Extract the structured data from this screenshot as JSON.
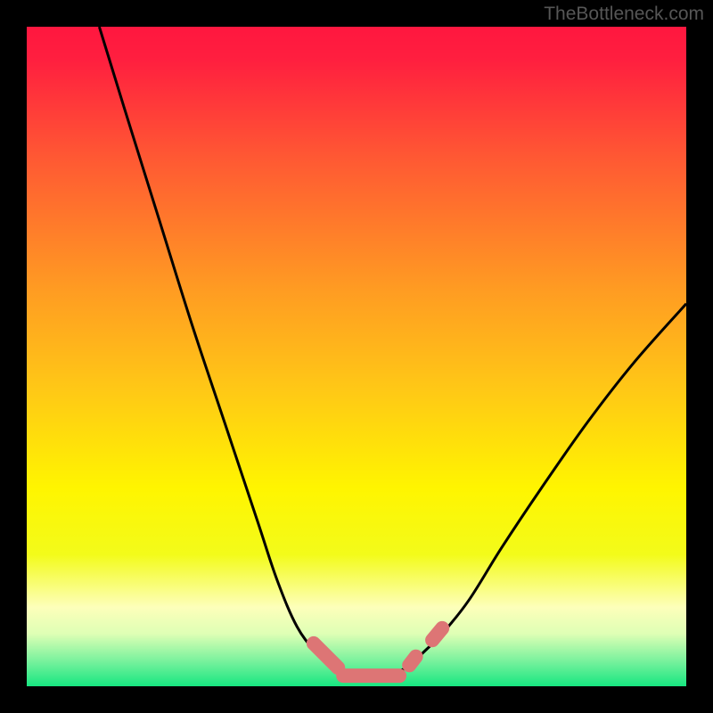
{
  "watermark": "TheBottleneck.com",
  "colors": {
    "frame": "#000000",
    "gradient_stops": [
      {
        "offset": 0.0,
        "color": "#ff173f"
      },
      {
        "offset": 0.05,
        "color": "#ff1f3f"
      },
      {
        "offset": 0.2,
        "color": "#ff5933"
      },
      {
        "offset": 0.4,
        "color": "#ff9c22"
      },
      {
        "offset": 0.55,
        "color": "#ffc816"
      },
      {
        "offset": 0.7,
        "color": "#fff500"
      },
      {
        "offset": 0.8,
        "color": "#f3fb1a"
      },
      {
        "offset": 0.88,
        "color": "#fdffba"
      },
      {
        "offset": 0.92,
        "color": "#dfffb5"
      },
      {
        "offset": 0.96,
        "color": "#7df29e"
      },
      {
        "offset": 1.0,
        "color": "#17e681"
      }
    ],
    "curve": "#000000",
    "overlay": "#dd7575"
  },
  "chart_data": {
    "type": "line",
    "title": "",
    "xlabel": "",
    "ylabel": "",
    "xlim": [
      0,
      100
    ],
    "ylim": [
      0,
      100
    ],
    "grid": false,
    "series": [
      {
        "name": "left-curve",
        "x": [
          11,
          15,
          20,
          25,
          30,
          35,
          38,
          41,
          44,
          46,
          48,
          50
        ],
        "y": [
          100,
          87,
          71,
          55,
          40,
          25,
          16,
          9,
          5,
          3,
          2,
          1
        ]
      },
      {
        "name": "right-curve",
        "x": [
          50,
          55,
          58,
          60,
          63,
          67,
          72,
          78,
          85,
          92,
          100
        ],
        "y": [
          1,
          2,
          3,
          5,
          8,
          13,
          21,
          30,
          40,
          49,
          58
        ]
      },
      {
        "name": "overlay-segments",
        "segments": [
          {
            "x": [
              43.5,
              47.2
            ],
            "y": [
              6.5,
              2.8
            ]
          },
          {
            "x": [
              48.0,
              56.5
            ],
            "y": [
              1.6,
              1.6
            ]
          },
          {
            "x": [
              58.0,
              59.0
            ],
            "y": [
              3.2,
              4.5
            ]
          },
          {
            "x": [
              61.5,
              63.0
            ],
            "y": [
              7.0,
              8.8
            ]
          }
        ]
      }
    ]
  }
}
